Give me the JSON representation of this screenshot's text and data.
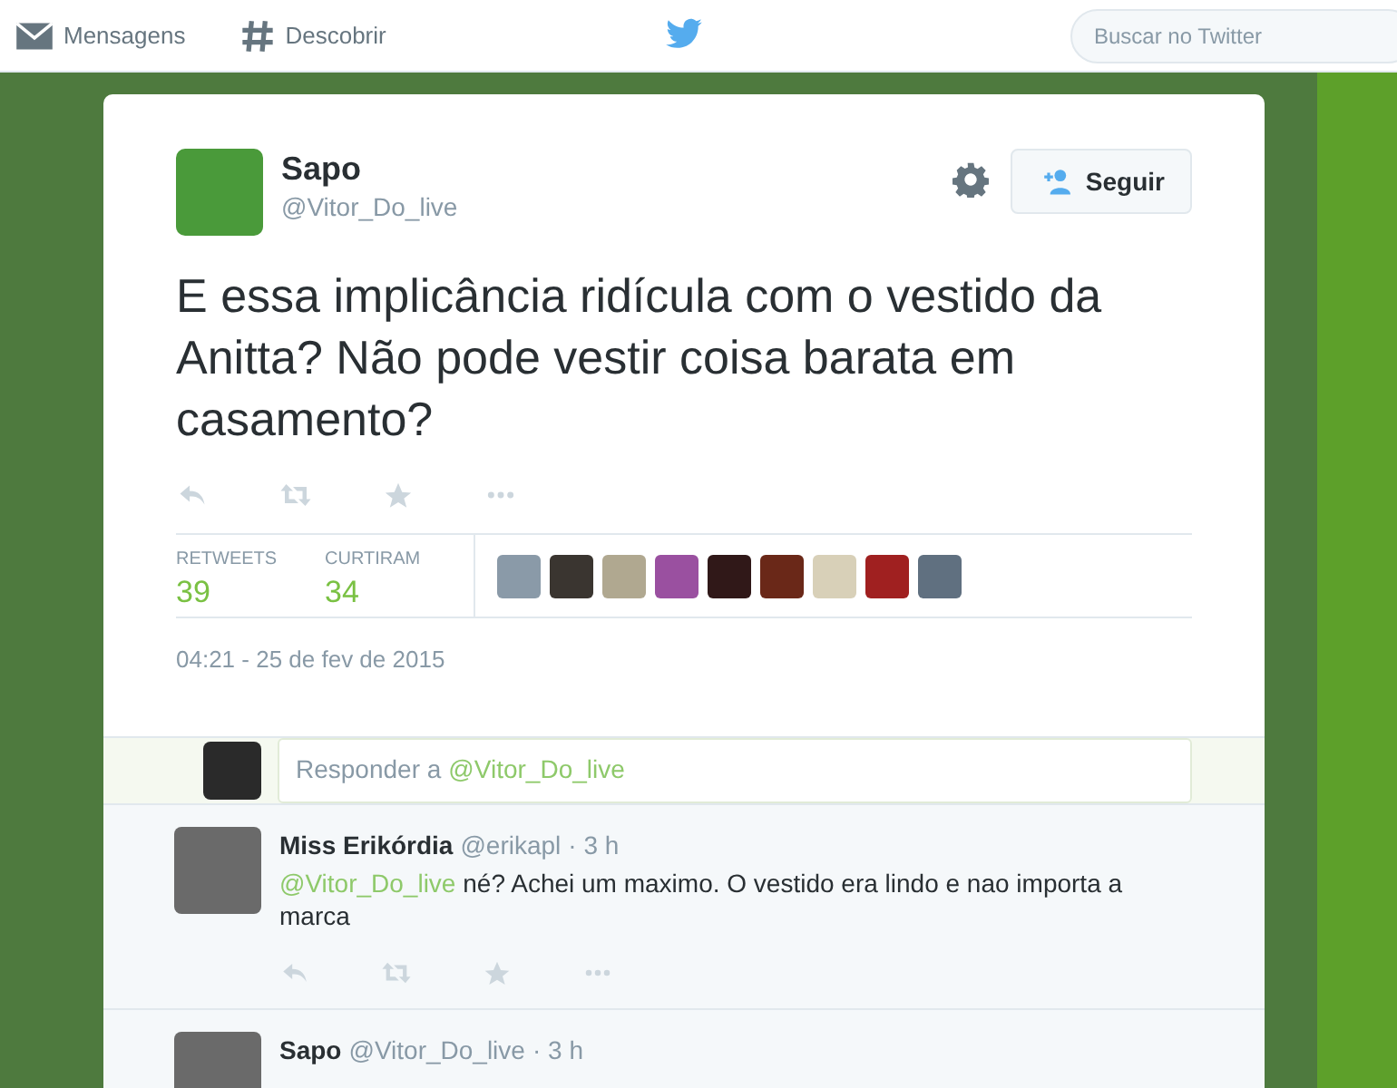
{
  "nav": {
    "items": [
      {
        "kind": "messages",
        "label": "Mensagens"
      },
      {
        "kind": "discover",
        "label": "Descobrir"
      }
    ],
    "search": {
      "placeholder": "Buscar no Twitter"
    }
  },
  "tweet": {
    "author": {
      "name": "Sapo",
      "handle": "@Vitor_Do_live"
    },
    "follow_button": "Seguir",
    "text": "E essa implicância ridícula com o vestido da Anitta? Não pode vestir coisa barata em casamento?",
    "stats": [
      {
        "label": "RETWEETS",
        "value": "39"
      },
      {
        "label": "CURTIRAM",
        "value": "34"
      }
    ],
    "liker_avatars": [
      {
        "color": "#8a9aa8"
      },
      {
        "color": "#3a3530"
      },
      {
        "color": "#b0a890"
      },
      {
        "color": "#9a50a0"
      },
      {
        "color": "#301818"
      },
      {
        "color": "#6a2818"
      },
      {
        "color": "#d8d0b8"
      },
      {
        "color": "#a02020"
      },
      {
        "color": "#607080"
      }
    ],
    "timestamp": "04:21 - 25 de fev de 2015"
  },
  "reply_box": {
    "placeholder": "Responder a",
    "mention": "@Vitor_Do_live"
  },
  "replies": [
    {
      "name": "Miss Erikórdia",
      "handle": "@erikapl",
      "time": "· 3 h",
      "mention": "@Vitor_Do_live",
      "text": " né? Achei um maximo. O vestido era lindo e nao importa a marca"
    },
    {
      "name": "Sapo",
      "handle": "@Vitor_Do_live",
      "time": "· 3 h"
    }
  ]
}
